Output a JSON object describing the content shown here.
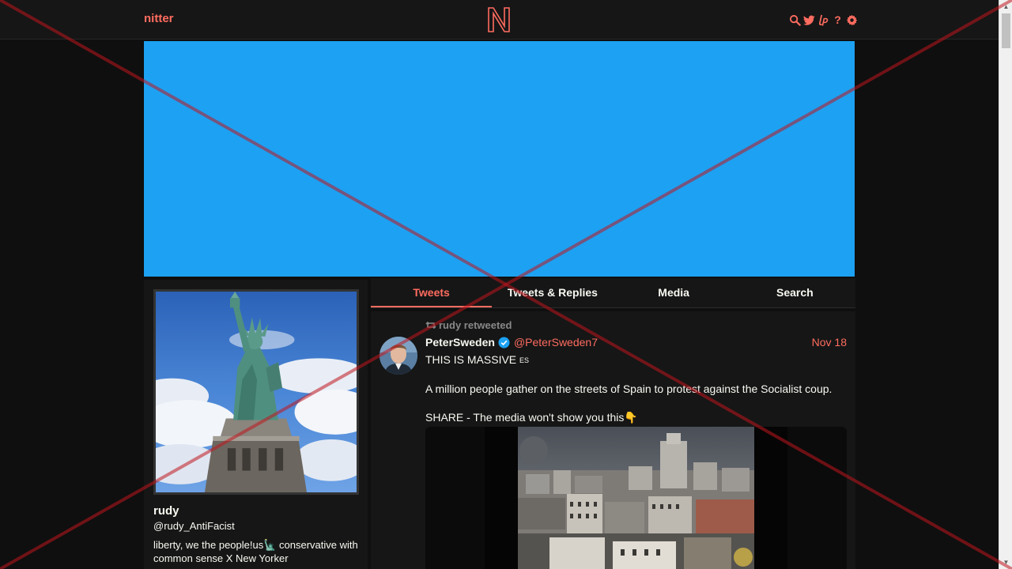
{
  "nav": {
    "brand": "nitter",
    "logo_letter": "N",
    "icons": [
      "search-icon",
      "twitter-bird-icon",
      "liberapay-icon",
      "help-icon",
      "settings-gear-icon"
    ],
    "help_glyph": "?"
  },
  "colors": {
    "accent": "#ff6c60",
    "banner": "#1da1f2",
    "background": "#0f0f0f",
    "panel": "#161616",
    "muted": "#888889",
    "overlay_x": "#c0161e"
  },
  "profile": {
    "fullname": "rudy",
    "username": "@rudy_AntiFacist",
    "bio": "liberty, we the people!us🗽 conservative with common sense X New Yorker"
  },
  "tabs": [
    {
      "label": "Tweets",
      "active": true
    },
    {
      "label": "Tweets & Replies",
      "active": false
    },
    {
      "label": "Media",
      "active": false
    },
    {
      "label": "Search",
      "active": false
    }
  ],
  "tweet": {
    "retweet_label": "rudy retweeted",
    "fullname": "PeterSweden",
    "username": "@PeterSweden7",
    "date": "Nov 18",
    "line1": "THIS IS MASSIVE ",
    "flag": "ES",
    "line2": "A million people gather on the streets of Spain to protest against the Socialist coup.",
    "line3": "SHARE - The media won't show you this👇"
  }
}
